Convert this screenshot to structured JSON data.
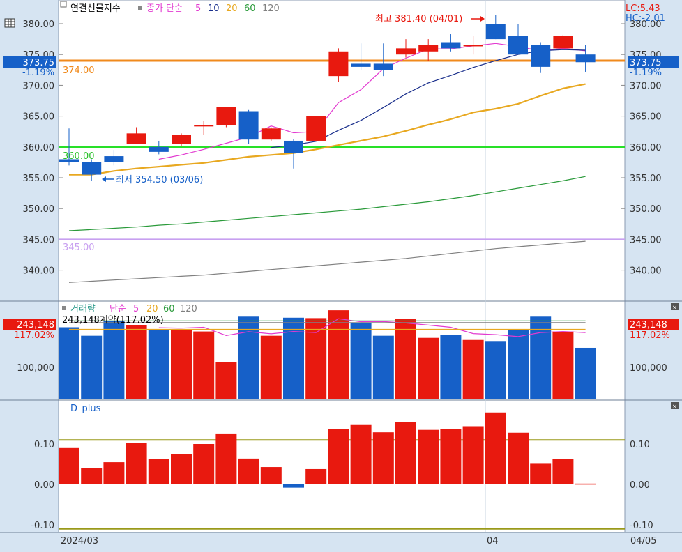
{
  "header": {
    "main_title": "연결선물지수",
    "ma_label": "종가 단순",
    "ma_periods": [
      "5",
      "10",
      "20",
      "60",
      "120"
    ],
    "lc_label": "LC:5.43",
    "hc_label": "HC:-2.01"
  },
  "colors": {
    "up": "#e8190f",
    "down": "#1660c8",
    "ma5": "#e23ad0",
    "ma10": "#1a2f8c",
    "ma20": "#e8a820",
    "ma60": "#2a9a3a",
    "ma120": "#808080",
    "hline_374": "#f08a1c",
    "hline_360": "#28e028",
    "hline_345": "#c8a0f0",
    "panel_bg": "#ffffff",
    "frame_bg": "#d6e4f2",
    "dplus_ref": "#9a9a1a"
  },
  "price_panel": {
    "y_ticks": [
      "380.00",
      "375.00",
      "370.00",
      "365.00",
      "360.00",
      "355.00",
      "350.00",
      "345.00",
      "340.00"
    ],
    "current_price": "373.75",
    "current_change": "-1.19%",
    "hline_labels": [
      "374.00",
      "360.00",
      "345.00"
    ],
    "high_annotation": "최고 381.40 (04/01)",
    "low_annotation": "최저 354.50 (03/06)"
  },
  "volume_panel": {
    "title": "거래량",
    "ma_label": "단순",
    "ma_periods": [
      "5",
      "20",
      "60",
      "120"
    ],
    "info_text": "243,148계약(117.02%)",
    "y_tick": "100,000",
    "current_value": "243,148",
    "current_pct": "117.02%"
  },
  "dplus_panel": {
    "title": "D_plus",
    "y_ticks": [
      "0.10",
      "0.00",
      "-0.10"
    ]
  },
  "x_axis": {
    "labels": [
      "2024/03",
      "04",
      "04/05"
    ]
  },
  "chart_data": [
    {
      "type": "candlestick",
      "title": "연결선물지수",
      "ylim": [
        336,
        382
      ],
      "candles": [
        {
          "o": 358.0,
          "h": 363.0,
          "l": 357.0,
          "c": 357.5
        },
        {
          "o": 357.5,
          "h": 358.0,
          "l": 354.5,
          "c": 355.5
        },
        {
          "o": 358.5,
          "h": 359.5,
          "l": 357.0,
          "c": 357.5
        },
        {
          "o": 360.5,
          "h": 363.2,
          "l": 360.5,
          "c": 362.2
        },
        {
          "o": 360.0,
          "h": 361.0,
          "l": 358.8,
          "c": 359.2
        },
        {
          "o": 360.5,
          "h": 362.2,
          "l": 360.2,
          "c": 362.0
        },
        {
          "o": 363.5,
          "h": 364.2,
          "l": 362.0,
          "c": 363.5
        },
        {
          "o": 363.5,
          "h": 366.5,
          "l": 363.2,
          "c": 366.5
        },
        {
          "o": 365.8,
          "h": 366.0,
          "l": 360.5,
          "c": 361.2
        },
        {
          "o": 361.2,
          "h": 363.2,
          "l": 361.0,
          "c": 363.0
        },
        {
          "o": 361.0,
          "h": 361.3,
          "l": 356.5,
          "c": 359.0
        },
        {
          "o": 361.0,
          "h": 365.0,
          "l": 361.0,
          "c": 365.0
        },
        {
          "o": 371.5,
          "h": 376.0,
          "l": 370.5,
          "c": 375.5
        },
        {
          "o": 373.5,
          "h": 376.8,
          "l": 372.5,
          "c": 373.0
        },
        {
          "o": 373.5,
          "h": 376.8,
          "l": 371.5,
          "c": 372.5
        },
        {
          "o": 375.0,
          "h": 377.5,
          "l": 374.5,
          "c": 376.0
        },
        {
          "o": 375.5,
          "h": 377.5,
          "l": 374.0,
          "c": 376.5
        },
        {
          "o": 377.0,
          "h": 378.3,
          "l": 375.5,
          "c": 376.0
        },
        {
          "o": 376.5,
          "h": 378.0,
          "l": 375.0,
          "c": 376.5
        },
        {
          "o": 380.0,
          "h": 381.4,
          "l": 377.5,
          "c": 377.5
        },
        {
          "o": 378.0,
          "h": 380.0,
          "l": 375.0,
          "c": 375.0
        },
        {
          "o": 376.5,
          "h": 377.0,
          "l": 372.0,
          "c": 373.0
        },
        {
          "o": 376.0,
          "h": 378.2,
          "l": 376.0,
          "c": 378.0
        },
        {
          "o": 375.0,
          "h": 376.5,
          "l": 372.2,
          "c": 373.75
        }
      ],
      "series": [
        {
          "name": "5",
          "values": [
            null,
            null,
            null,
            null,
            358.0,
            358.7,
            359.6,
            360.6,
            361.6,
            363.4,
            362.3,
            362.5,
            367.2,
            369.3,
            372.7,
            374.4,
            375.9,
            375.9,
            376.4,
            376.8,
            376.3,
            375.6,
            376.0,
            375.6
          ]
        },
        {
          "name": "10",
          "values": [
            null,
            null,
            null,
            null,
            null,
            null,
            null,
            null,
            null,
            359.9,
            360.3,
            360.9,
            362.7,
            364.3,
            366.4,
            368.6,
            370.4,
            371.6,
            372.9,
            374.0,
            375.0,
            375.6,
            375.8,
            375.7
          ]
        },
        {
          "name": "20",
          "values": [
            355.5,
            355.5,
            356.1,
            356.5,
            356.8,
            357.1,
            357.4,
            357.9,
            358.4,
            358.7,
            359.0,
            359.6,
            360.3,
            361.0,
            361.7,
            362.6,
            363.6,
            364.5,
            365.6,
            366.2,
            367.0,
            368.3,
            369.5,
            370.2
          ]
        },
        {
          "name": "60",
          "values": [
            346.4,
            346.6,
            346.8,
            347.0,
            347.3,
            347.5,
            347.8,
            348.1,
            348.4,
            348.7,
            349.0,
            349.3,
            349.6,
            349.9,
            350.3,
            350.7,
            351.1,
            351.6,
            352.1,
            352.7,
            353.3,
            353.9,
            354.5,
            355.2
          ]
        },
        {
          "name": "120",
          "values": [
            338.0,
            338.2,
            338.4,
            338.6,
            338.8,
            339.0,
            339.2,
            339.5,
            339.8,
            340.1,
            340.4,
            340.7,
            341.0,
            341.3,
            341.6,
            341.9,
            342.3,
            342.7,
            343.1,
            343.5,
            343.8,
            344.1,
            344.4,
            344.7
          ]
        }
      ],
      "hlines": [
        374.0,
        360.0,
        345.0
      ]
    },
    {
      "type": "bar",
      "title": "거래량",
      "ylim": [
        0,
        450000
      ],
      "values": [
        340000,
        300000,
        370000,
        350000,
        330000,
        330000,
        320000,
        175000,
        390000,
        300000,
        385000,
        383000,
        420000,
        360000,
        300000,
        380000,
        290000,
        305000,
        280000,
        275000,
        330000,
        390000,
        320000,
        243148
      ],
      "series": [
        {
          "name": "5",
          "values": [
            null,
            null,
            null,
            null,
            338000,
            336000,
            340000,
            301000,
            319000,
            309000,
            320000,
            315000,
            380000,
            366000,
            367000,
            360000,
            350000,
            340000,
            310000,
            305000,
            296000,
            315000,
            320000,
            315000
          ]
        },
        {
          "name": "20",
          "values": [
            330000,
            330000,
            330000,
            330000,
            330000,
            330000,
            330000,
            330000,
            330000,
            330000,
            330000,
            330000,
            330000,
            330000,
            330000,
            330000,
            330000,
            330000,
            330000,
            330000,
            330000,
            330000,
            330000,
            330000
          ]
        },
        {
          "name": "60",
          "values": [
            370000,
            370000,
            370000,
            370000,
            370000,
            370000,
            370000,
            370000,
            370000,
            370000,
            370000,
            370000,
            370000,
            370000,
            370000,
            370000,
            370000,
            370000,
            370000,
            370000,
            370000,
            370000,
            370000,
            370000
          ]
        },
        {
          "name": "120",
          "values": [
            362000,
            362000,
            362000,
            362000,
            362000,
            362000,
            362000,
            362000,
            362000,
            362000,
            362000,
            362000,
            362000,
            362000,
            362000,
            362000,
            362000,
            362000,
            362000,
            362000,
            362000,
            362000,
            362000,
            362000
          ]
        }
      ]
    },
    {
      "type": "bar",
      "title": "D_plus",
      "ylim": [
        -0.13,
        0.18
      ],
      "values": [
        0.09,
        0.04,
        0.055,
        0.102,
        0.063,
        0.075,
        0.1,
        0.126,
        0.064,
        0.043,
        -0.008,
        0.038,
        0.137,
        0.147,
        0.129,
        0.155,
        0.135,
        0.137,
        0.144,
        0.178,
        0.128,
        0.051,
        0.063,
        0.002
      ],
      "reference_lines": [
        0.11,
        -0.11
      ]
    }
  ]
}
